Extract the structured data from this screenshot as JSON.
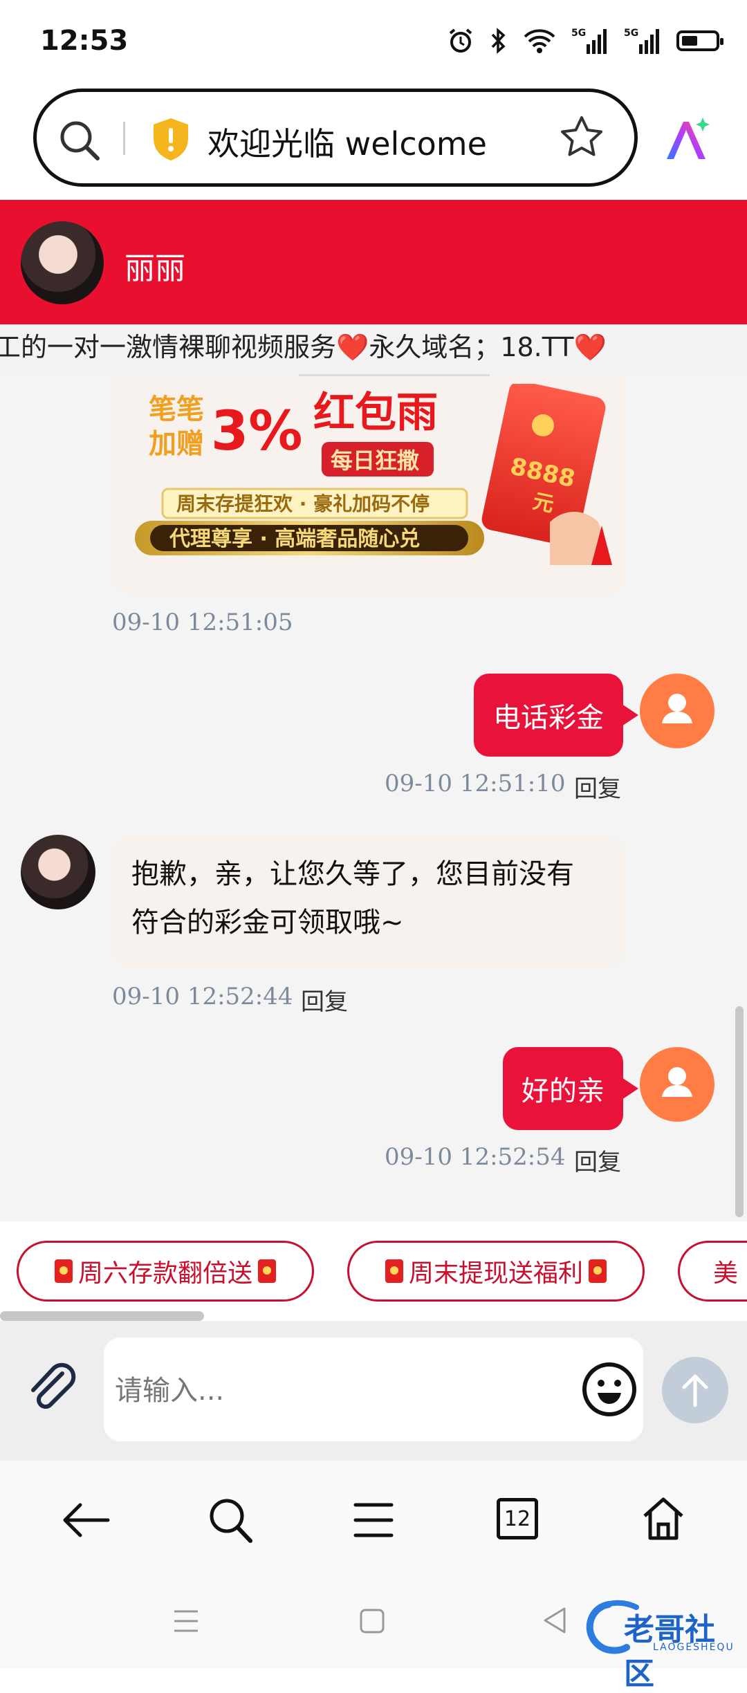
{
  "status_bar": {
    "time": "12:53"
  },
  "address_bar": {
    "title": "欢迎光临 welcome"
  },
  "chat_header": {
    "name": "丽丽"
  },
  "marquee": {
    "text": "工的一对一激情裸聊视频服务❤️永久域名；18.TT❤️"
  },
  "banner": {
    "line1": "笔笔加赠",
    "percent": "3%",
    "title": "红包雨",
    "tag": "每日狂撒",
    "sub1": "周末存提狂欢 · 豪礼加码不停",
    "sub2": "代理尊享 · 高端奢品随心兑",
    "envelope_amount": "8888",
    "envelope_unit": "元"
  },
  "messages": [
    {
      "from": "agent",
      "type": "banner",
      "time": "09-10 12:51:05"
    },
    {
      "from": "me",
      "text": "电话彩金",
      "time": "09-10 12:51:10",
      "reply": "回复"
    },
    {
      "from": "agent",
      "text_line1": "抱歉，亲，让您久等了，您目前没有",
      "text_line2": "符合的彩金可领取哦~",
      "time": "09-10 12:52:44",
      "reply": "回复"
    },
    {
      "from": "me",
      "text": "好的亲",
      "time": "09-10 12:52:54",
      "reply": "回复"
    }
  ],
  "quick_chips": [
    "周六存款翻倍送",
    "周末提现送福利",
    "美"
  ],
  "input": {
    "placeholder": "请输入..."
  },
  "browser_nav": {
    "tabs_count": "12"
  },
  "watermark": {
    "text": "老哥社区",
    "sub": "LAOGESHEQU"
  },
  "colors": {
    "brand_red": "#e8102e",
    "avatar_orange": "#ff7d45"
  }
}
